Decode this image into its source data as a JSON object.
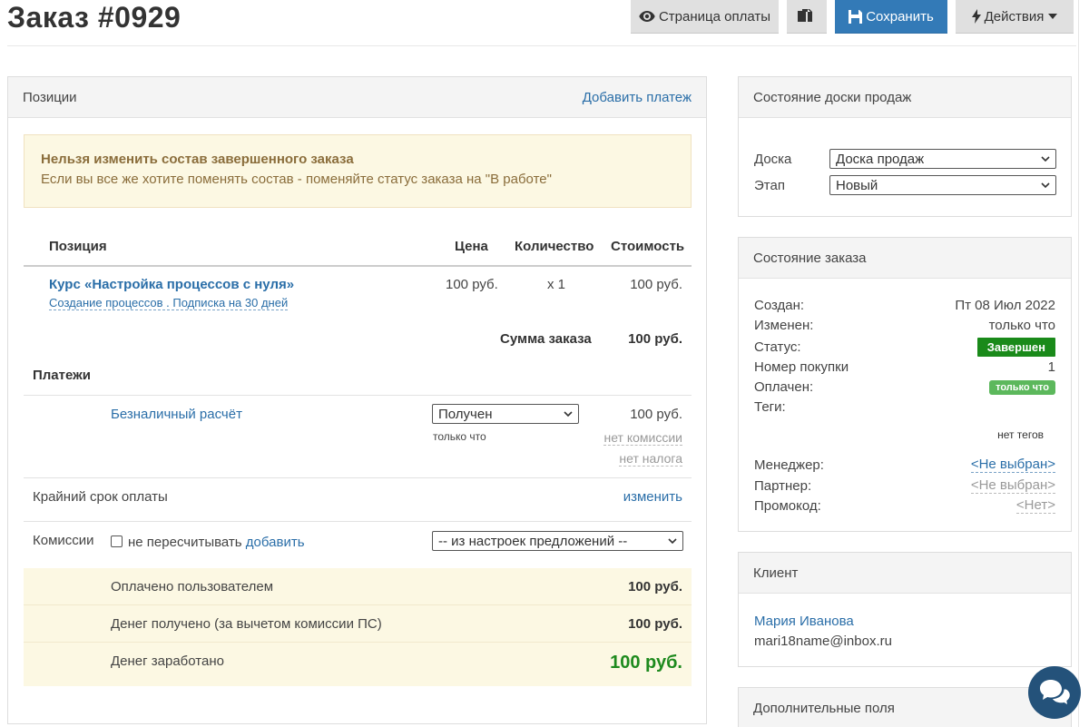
{
  "header": {
    "title": "Заказ #0929",
    "buttons": {
      "payment_page": "Страница оплаты",
      "save": "Сохранить",
      "actions": "Действия"
    }
  },
  "positions_panel": {
    "title": "Позиции",
    "add_payment": "Добавить платеж",
    "warning": {
      "title": "Нельзя изменить состав завершенного заказа",
      "text": "Если вы все же хотите поменять состав - поменяйте статус заказа на \"В работе\""
    },
    "columns": {
      "position": "Позиция",
      "price": "Цена",
      "quantity": "Количество",
      "cost": "Стоимость"
    },
    "item": {
      "name": "Курс «Настройка процессов с нуля»",
      "subtitle": "Создание процессов . Подписка на 30 дней",
      "price": "100 руб.",
      "quantity": "x 1",
      "cost": "100 руб."
    },
    "order_total": {
      "label": "Сумма заказа",
      "value": "100 руб."
    },
    "payments": {
      "title": "Платежи",
      "method": "Безналичный расчёт",
      "status_select": "Получен",
      "status_time": "только что",
      "amount": "100 руб.",
      "no_commission": "нет комиссии",
      "no_tax": "нет налога"
    },
    "deadline": {
      "label": "Крайний срок оплаты",
      "change": "изменить"
    },
    "commissions": {
      "label": "Комиссии",
      "checkbox_label": "не пересчитывать",
      "add": "добавить",
      "select": "-- из настроек предложений --"
    },
    "summary": [
      {
        "label": "Оплачено пользователем",
        "value": "100 руб."
      },
      {
        "label": "Денег получено (за вычетом комиссии ПС)",
        "value": "100 руб."
      },
      {
        "label": "Денег заработано",
        "value": "100 руб."
      }
    ]
  },
  "sales_board_panel": {
    "title": "Состояние доски продаж",
    "board_label": "Доска",
    "board_value": "Доска продаж",
    "stage_label": "Этап",
    "stage_value": "Новый"
  },
  "order_state_panel": {
    "title": "Состояние заказа",
    "created_label": "Создан:",
    "created_value": "Пт 08 Июл 2022",
    "modified_label": "Изменен:",
    "modified_value": "только что",
    "status_label": "Статус:",
    "status_value": "Завершен",
    "purchase_label": "Номер покупки",
    "purchase_value": "1",
    "paid_label": "Оплачен:",
    "paid_value": "только что",
    "tags_label": "Теги:",
    "tags_value": "нет тегов",
    "manager_label": "Менеджер:",
    "manager_value": "<Не выбран>",
    "partner_label": "Партнер:",
    "partner_value": "<Не выбран>",
    "promo_label": "Промокод:",
    "promo_value": "<Нет>"
  },
  "client_panel": {
    "title": "Клиент",
    "name": "Мария Иванова",
    "email": "mari18name@inbox.ru"
  },
  "extra_fields_panel": {
    "title": "Дополнительные поля"
  },
  "colors": {
    "primary": "#337ab7",
    "link": "#2a6ea8",
    "warning_bg": "#fcf8e3",
    "success": "#1a8a1a",
    "earned": "#1e8a1e"
  }
}
